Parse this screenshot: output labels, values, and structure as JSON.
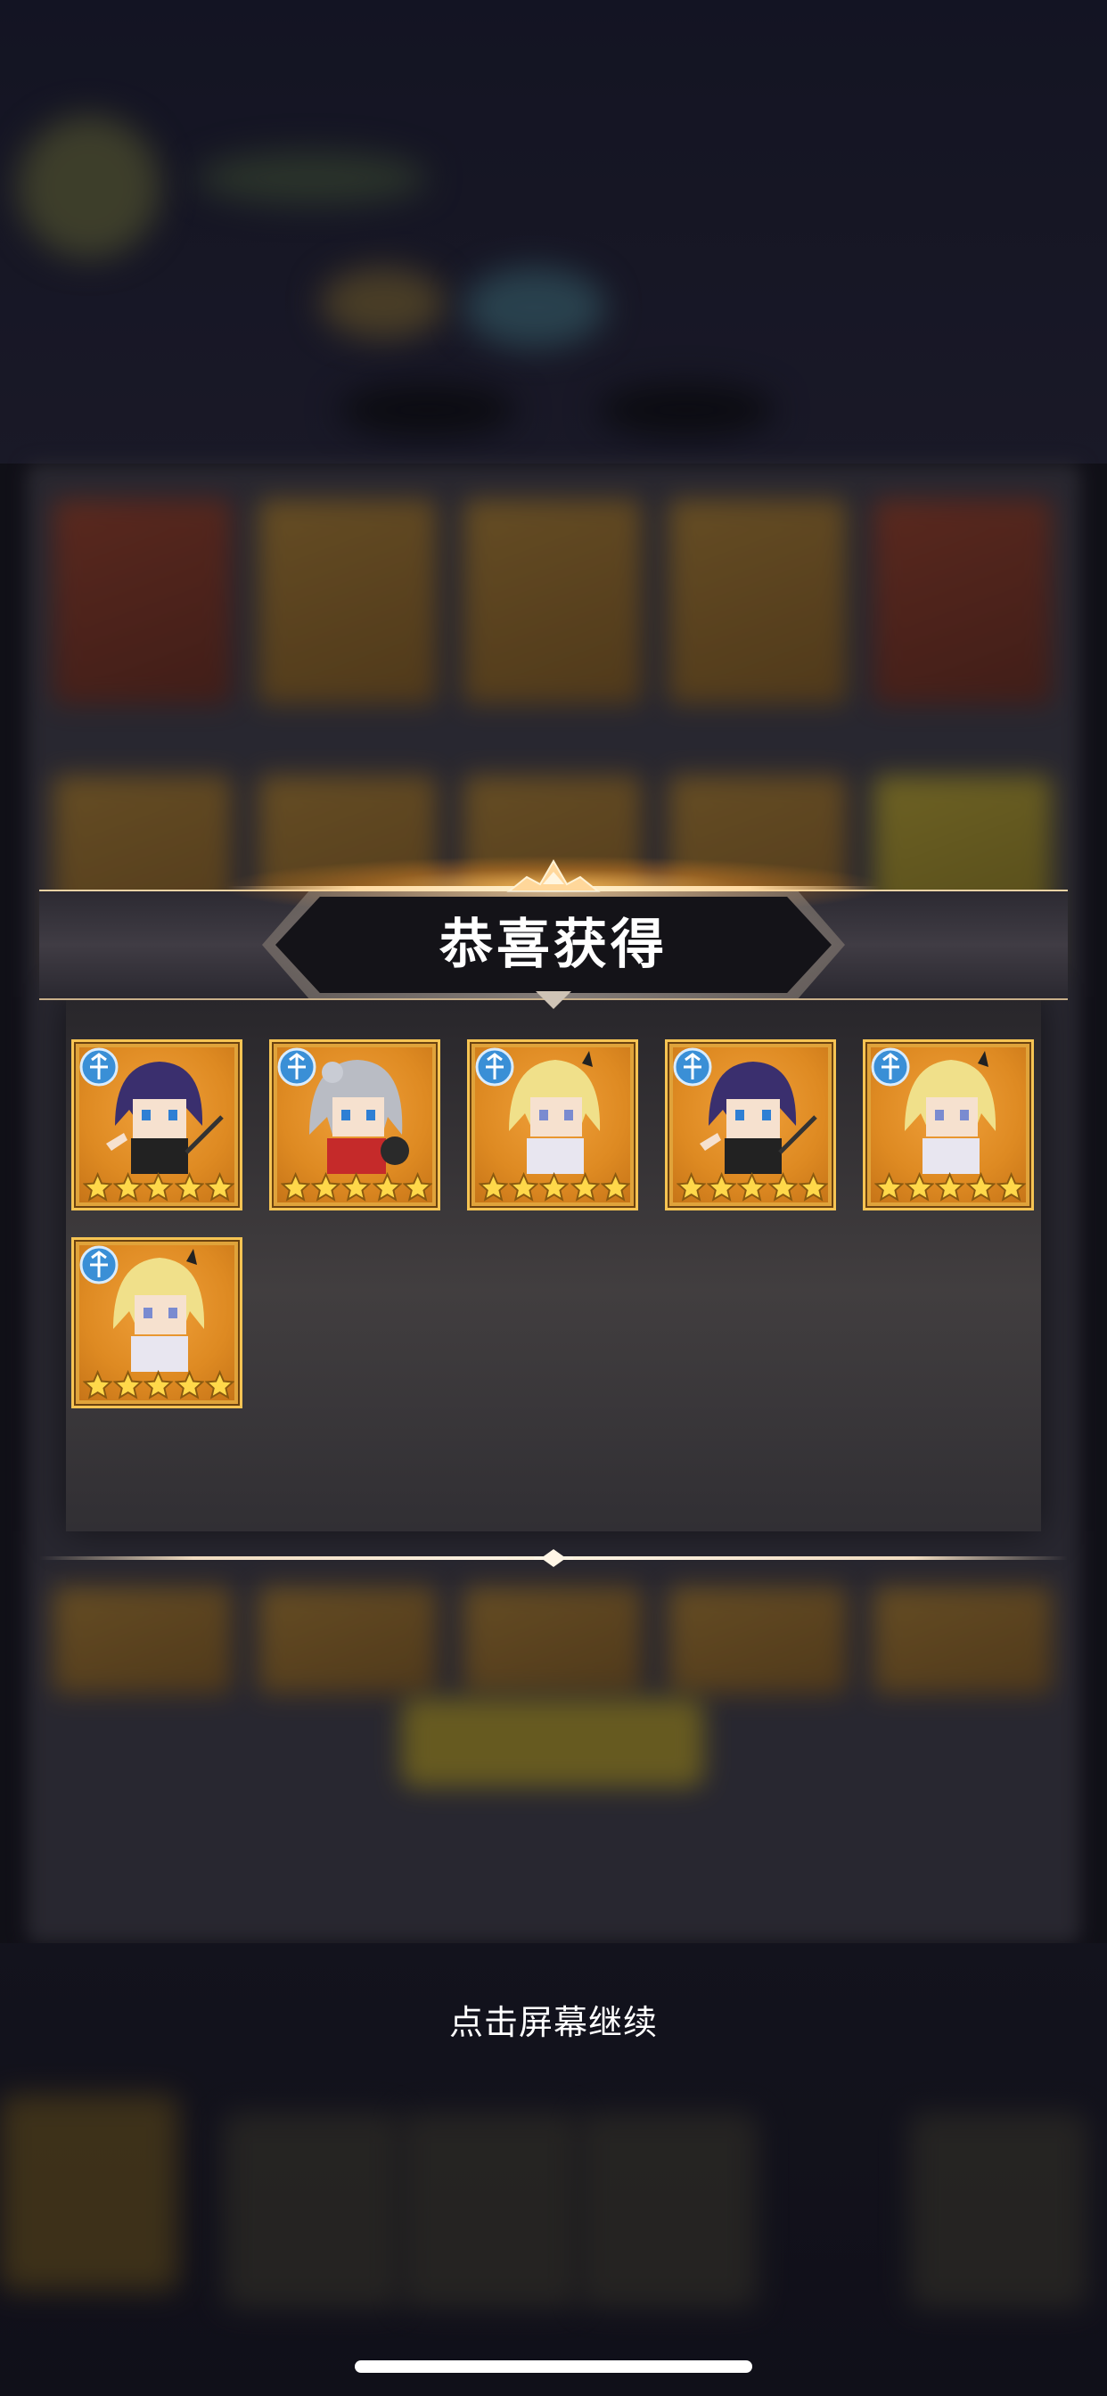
{
  "dialog": {
    "title": "恭喜获得"
  },
  "rewards": [
    {
      "hero": "purple-hair-hero",
      "stars": 5,
      "class": "ranger"
    },
    {
      "hero": "silver-hair-hero",
      "stars": 5,
      "class": "ranger"
    },
    {
      "hero": "blonde-hair-hero",
      "stars": 5,
      "class": "ranger"
    },
    {
      "hero": "purple-hair-hero",
      "stars": 5,
      "class": "ranger"
    },
    {
      "hero": "blonde-hair-hero",
      "stars": 5,
      "class": "ranger"
    },
    {
      "hero": "blonde-hair-hero",
      "stars": 5,
      "class": "ranger"
    }
  ],
  "prompt": {
    "continue_text": "点击屏幕继续"
  },
  "colors": {
    "card_gold": "#e0a33a",
    "card_border": "#f6c453",
    "star": "#ffd84a",
    "class_icon": "#3a8fd6"
  }
}
